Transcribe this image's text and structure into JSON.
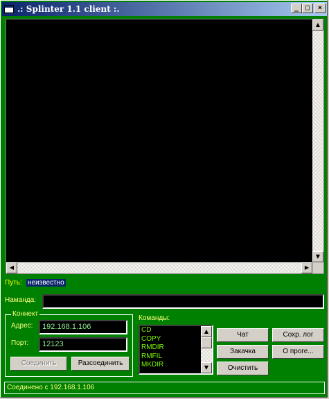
{
  "window": {
    "title": ".: Splinter 1.1 client :.",
    "buttons": {
      "minimize": "_",
      "maximize": "□",
      "close": "×"
    }
  },
  "path": {
    "label": "Путь:",
    "value": "неизвестно"
  },
  "command_line": {
    "label": "Наманда:",
    "value": ""
  },
  "connect": {
    "group_title": "Коннект",
    "address_label": "Адрес:",
    "address_value": "192.168.1.106",
    "port_label": "Порт:",
    "port_value": "12123",
    "connect_button": "Соединить",
    "disconnect_button": "Разсоединить"
  },
  "commands": {
    "label": "Команды:",
    "items": [
      "CD",
      "COPY",
      "RMDIR",
      "RMFIL",
      "MKDIR"
    ]
  },
  "actions": {
    "chat": "Чат",
    "save_log": "Сохр. лог",
    "upload": "Закачка",
    "about": "О проге...",
    "clear": "Очистить"
  },
  "status": {
    "text": "Соединено с 192.168.1.106"
  }
}
